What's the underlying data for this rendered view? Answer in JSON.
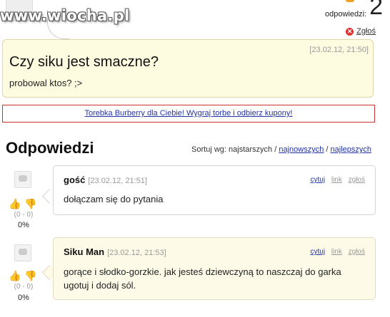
{
  "watermark": "www.wiocha.pl",
  "answers_count": {
    "label": "odpowiedzi:",
    "value": "2"
  },
  "report_label": "Zgłoś",
  "question": {
    "date": "[23.02.12, 21:50]",
    "title": "Czy siku jest smaczne?",
    "body": "probowal ktos? ;>"
  },
  "ad": {
    "text": "Torebka Burberry dla Ciebie! Wygraj torbe i odbierz kupony!"
  },
  "answers_section": {
    "title": "Odpowiedzi",
    "sort_label": "Sortuj wg:",
    "sort_current": "najstarszych",
    "sort_options": [
      "najnowszych",
      "najlepszych"
    ],
    "separator": "/"
  },
  "answers": [
    {
      "author": "gość",
      "date": "[23.02.12, 21:51]",
      "actions": [
        "cytuj",
        "link",
        "zgłoś"
      ],
      "text": "dołączam się do pytania",
      "votes": "(0 - 0)",
      "percent": "0%"
    },
    {
      "author": "Siku Man",
      "date": "[23.02.12, 21:53]",
      "actions": [
        "cytuj",
        "link",
        "zgłoś"
      ],
      "text": "gorące i słodko-gorzkie. jak jesteś dziewczyną to naszczaj do garka ugotuj i dodaj sól.",
      "votes": "(0 - 0)",
      "percent": "0%"
    }
  ]
}
